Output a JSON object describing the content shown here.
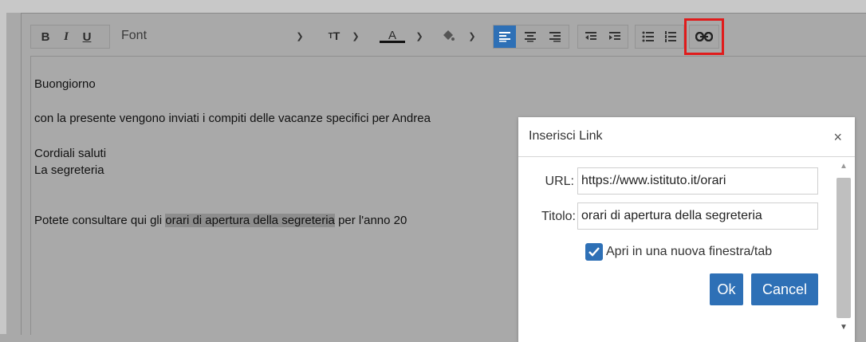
{
  "toolbar": {
    "bold": "B",
    "italic": "I",
    "underline": "U",
    "font_label": "Font",
    "font_size_glyph": "ᴛᴛ",
    "text_color_glyph": "A",
    "icons": [
      "bold-icon",
      "italic-icon",
      "underline-icon",
      "font-select",
      "font-size-icon",
      "text-color-icon",
      "fill-color-icon",
      "align-left-icon",
      "align-center-icon",
      "align-right-icon",
      "outdent-icon",
      "indent-icon",
      "bullet-list-icon",
      "numbered-list-icon",
      "link-icon"
    ],
    "accent": "#2e70b6",
    "highlight_color": "#e01b1b"
  },
  "editor": {
    "line1": "Buongiorno",
    "line2": "con la presente vengono inviati i compiti delle vacanze specifici per Andrea",
    "line3": "Cordiali saluti",
    "line4": "La segreteria",
    "line5_prefix": "Potete consultare qui gli ",
    "line5_highlight": "orari di apertura della segreteria",
    "line5_suffix": " per l'anno 20"
  },
  "dialog": {
    "title": "Inserisci Link",
    "close": "×",
    "url_label": "URL:",
    "url_value": "https://www.istituto.it/orari",
    "title_label": "Titolo:",
    "title_value": "orari di apertura della segreteria",
    "checkbox_label": "Apri in una nuova finestra/tab",
    "checkbox_checked": true,
    "ok_label": "Ok",
    "cancel_label": "Cancel"
  }
}
